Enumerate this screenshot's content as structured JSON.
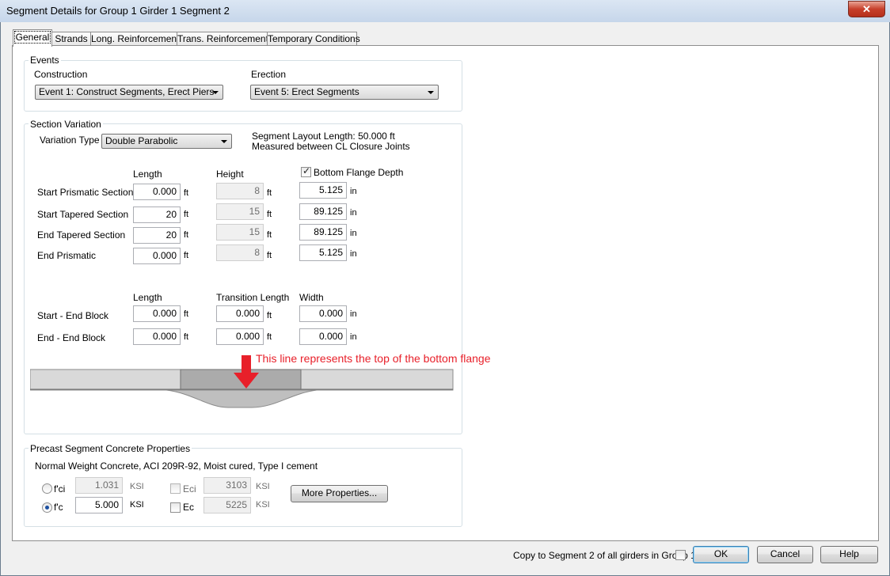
{
  "window": {
    "title": "Segment Details for Group 1 Girder 1 Segment 2",
    "close_label": "✕"
  },
  "tabs": [
    {
      "label": "General"
    },
    {
      "label": "Strands"
    },
    {
      "label": "Long. Reinforcement"
    },
    {
      "label": "Trans. Reinforcement"
    },
    {
      "label": "Temporary Conditions"
    }
  ],
  "events": {
    "group_label": "Events",
    "construction_label": "Construction",
    "construction_value": "Event 1: Construct Segments, Erect Piers",
    "erection_label": "Erection",
    "erection_value": "Event 5: Erect Segments"
  },
  "section": {
    "group_label": "Section Variation",
    "variation_label": "Variation Type",
    "variation_value": "Double Parabolic",
    "layout_length": "Segment Layout Length: 50.000 ft",
    "layout_measured": "Measured between CL Closure Joints",
    "col_length": "Length",
    "col_height": "Height",
    "bottom_flange_label": "Bottom Flange Depth",
    "bottom_flange_checked": true,
    "rows": [
      {
        "label": "Start Prismatic Section",
        "length": "0.000",
        "length_unit": "ft",
        "height": "8",
        "height_unit": "ft",
        "depth": "5.125",
        "depth_unit": "in"
      },
      {
        "label": "Start Tapered Section",
        "length": "20",
        "length_unit": "ft",
        "height": "15",
        "height_unit": "ft",
        "depth": "89.125",
        "depth_unit": "in"
      },
      {
        "label": "End Tapered Section",
        "length": "20",
        "length_unit": "ft",
        "height": "15",
        "height_unit": "ft",
        "depth": "89.125",
        "depth_unit": "in"
      },
      {
        "label": "End Prismatic",
        "length": "0.000",
        "length_unit": "ft",
        "height": "8",
        "height_unit": "ft",
        "depth": "5.125",
        "depth_unit": "in"
      }
    ],
    "eb_col_length": "Length",
    "eb_col_transition": "Transition Length",
    "eb_col_width": "Width",
    "end_blocks": [
      {
        "label": "Start - End Block",
        "length": "0.000",
        "length_unit": "ft",
        "transition": "0.000",
        "transition_unit": "ft",
        "width": "0.000",
        "width_unit": "in"
      },
      {
        "label": "End - End Block",
        "length": "0.000",
        "length_unit": "ft",
        "transition": "0.000",
        "transition_unit": "ft",
        "width": "0.000",
        "width_unit": "in"
      }
    ],
    "annotation": "This line represents the top of the bottom flange",
    "annotation_color": "#e8202a"
  },
  "concrete": {
    "group_label": "Precast Segment Concrete Properties",
    "description": "Normal Weight Concrete, ACI 209R-92, Moist cured, Type I cement",
    "fci_label": "f'ci",
    "fci_value": "1.031",
    "fci_unit": "KSI",
    "fci_selected": false,
    "fc_label": "f'c",
    "fc_value": "5.000",
    "fc_unit": "KSI",
    "fc_selected": true,
    "eci_label": "Eci",
    "eci_value": "3103",
    "eci_unit": "KSI",
    "eci_checked": false,
    "ec_label": "Ec",
    "ec_value": "5225",
    "ec_unit": "KSI",
    "ec_checked": false,
    "more_button": "More Properties..."
  },
  "footer": {
    "copy_label": "Copy to Segment 2 of all girders in Group 1",
    "copy_checked": false,
    "ok": "OK",
    "cancel": "Cancel",
    "help": "Help"
  }
}
